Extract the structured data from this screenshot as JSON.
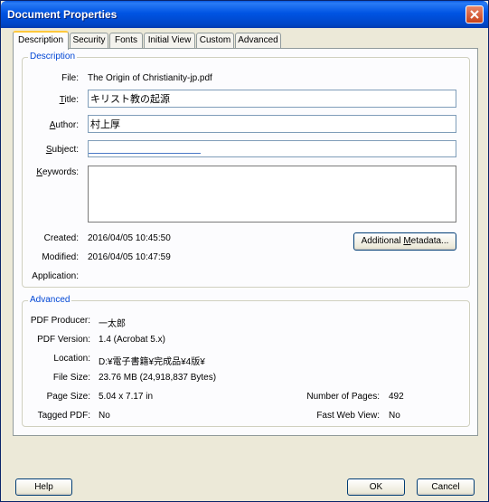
{
  "window": {
    "title": "Document Properties"
  },
  "tabs": [
    "Description",
    "Security",
    "Fonts",
    "Initial View",
    "Custom",
    "Advanced"
  ],
  "description": {
    "legend": "Description",
    "file_label": "File:",
    "file_value": "The Origin of Christianity-jp.pdf",
    "title_label": "Title:",
    "title_value": "キリスト教の起源",
    "author_label": "Author:",
    "author_value": "村上厚",
    "subject_label": "Subject:",
    "subject_value": "",
    "keywords_label": "Keywords:",
    "keywords_value": "",
    "created_label": "Created:",
    "created_value": "2016/04/05 10:45:50",
    "modified_label": "Modified:",
    "modified_value": "2016/04/05 10:47:59",
    "application_label": "Application:",
    "application_value": "",
    "metadata_button": "Additional Metadata..."
  },
  "advanced": {
    "legend": "Advanced",
    "producer_label": "PDF Producer:",
    "producer_value": "一太郎",
    "version_label": "PDF Version:",
    "version_value": "1.4 (Acrobat 5.x)",
    "location_label": "Location:",
    "location_value": "D:¥電子書籍¥完成品¥4版¥",
    "filesize_label": "File Size:",
    "filesize_value": "23.76 MB (24,918,837 Bytes)",
    "pagesize_label": "Page Size:",
    "pagesize_value": "5.04 x 7.17 in",
    "numpages_label": "Number of Pages:",
    "numpages_value": "492",
    "tagged_label": "Tagged PDF:",
    "tagged_value": "No",
    "fastweb_label": "Fast Web View:",
    "fastweb_value": "No"
  },
  "footer": {
    "help": "Help",
    "ok": "OK",
    "cancel": "Cancel"
  },
  "colors": {
    "titlebar": "#0054e3",
    "legend": "#0046d5",
    "close": "#c8421a"
  }
}
